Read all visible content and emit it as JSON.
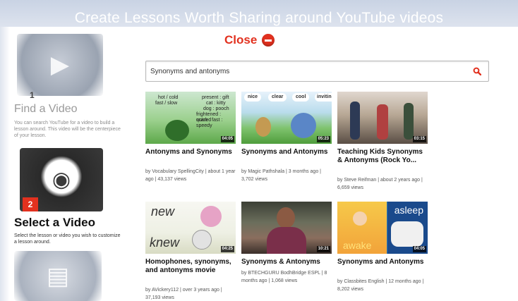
{
  "header": {
    "title": "Create Lessons Worth Sharing around YouTube videos"
  },
  "close": {
    "label": "Close"
  },
  "steps": [
    {
      "num": "1",
      "title": "Find a Video",
      "desc": "You can search YouTube for a video to build a lesson around. This video will be the centerpiece of your lesson."
    },
    {
      "num": "2",
      "title": "Select a Video",
      "desc": "Select the lesson or video you wish to customize a lesson around."
    }
  ],
  "search": {
    "value": "Synonyms and antonyms"
  },
  "videos": [
    {
      "title": "Antonyms and Synonyms",
      "meta": "by Vocabulary SpellingCity | about 1 year ago | 43,137 views",
      "duration": "04:05",
      "thumb_lines": [
        "hot / cold",
        "fast / slow",
        "present : gift",
        "cat : kitty",
        "dog : pooch",
        "frightened : scared",
        "quick : fast : speedy"
      ]
    },
    {
      "title": "Synonyms and Antonyms",
      "meta": "by Magic Pathshala | 3 months ago | 3,702 views",
      "duration": "05:23",
      "bubbles": [
        "nice",
        "clear",
        "cool",
        "inviting"
      ]
    },
    {
      "title": "Teaching Kids Synonyms & Antonyms (Rock Yo...",
      "meta": "by Steve Reifman | about 2 years ago | 6,659 views",
      "duration": "03:15"
    },
    {
      "title": "Homophones, synonyms, and antonyms movie",
      "meta": "by AVickery112 | over 3 years ago | 37,193 views",
      "duration": "04:25",
      "thumb_words": [
        "new",
        "knew"
      ]
    },
    {
      "title": "Synonyms & Antonyms",
      "meta": "by BTECHGURU BodhBridge ESPL | 8 months ago | 1,068 views",
      "duration": "10:21"
    },
    {
      "title": "Synonyms and Antonyms",
      "meta": "by Classbites English | 12 months ago | 8,202 views",
      "duration": "04:05",
      "thumb_words": [
        "asleep",
        "awake"
      ]
    }
  ]
}
